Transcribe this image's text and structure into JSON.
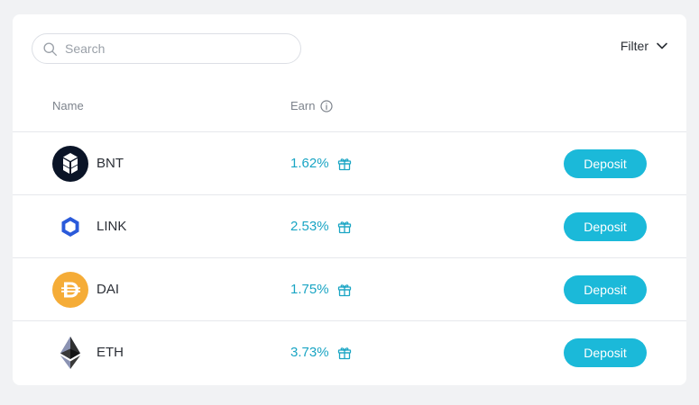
{
  "search": {
    "placeholder": "Search",
    "value": ""
  },
  "filter": {
    "label": "Filter"
  },
  "table": {
    "col_name": "Name",
    "col_earn": "Earn"
  },
  "rows": [
    {
      "symbol": "BNT",
      "rate": "1.62%",
      "action": "Deposit",
      "icon": "bancor-icon"
    },
    {
      "symbol": "LINK",
      "rate": "2.53%",
      "action": "Deposit",
      "icon": "chainlink-icon"
    },
    {
      "symbol": "DAI",
      "rate": "1.75%",
      "action": "Deposit",
      "icon": "dai-icon"
    },
    {
      "symbol": "ETH",
      "rate": "3.73%",
      "action": "Deposit",
      "icon": "ethereum-icon"
    }
  ],
  "colors": {
    "accent": "#1bb9d9",
    "rate_text": "#1aa5c4",
    "bnt_bg": "#0a1427",
    "link_blue": "#2a5ada",
    "dai_yellow": "#f5ac37"
  }
}
